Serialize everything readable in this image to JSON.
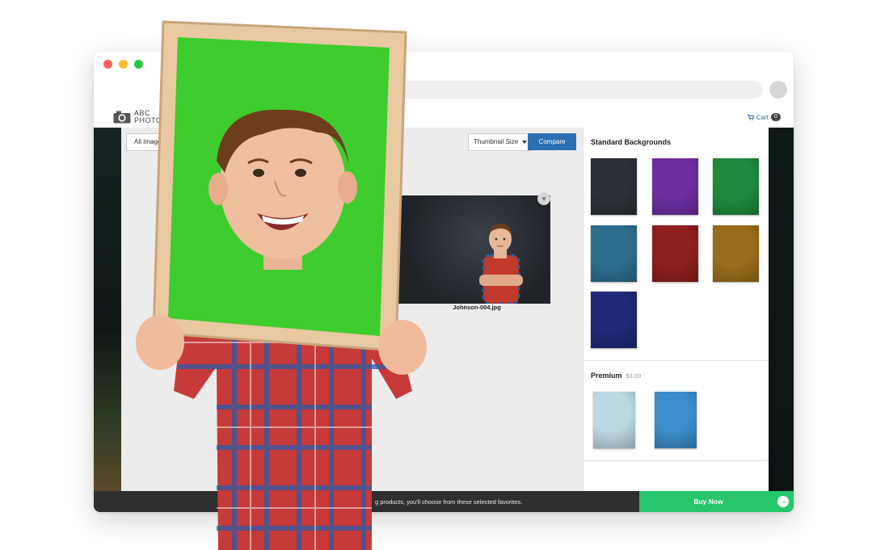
{
  "window": {
    "buttons": [
      "close",
      "minimize",
      "zoom"
    ]
  },
  "header": {
    "logo_line1": "ABC",
    "logo_line2": "PHOTOG",
    "cart_label": "Cart",
    "cart_count": "0",
    "cart_icon": "cart-icon",
    "logo_icon": "camera-icon"
  },
  "toolbar": {
    "all_images_label": "All Image",
    "thumbnail_size_label": "Thumbnail Size",
    "compare_label": "Compare"
  },
  "gallery": {
    "photo_filename": "Johnson-004.jpg",
    "favorite_icon": "heart-icon"
  },
  "sidebar": {
    "standard_heading": "Standard Backgrounds",
    "premium_heading": "Premium",
    "premium_price": "$3.00",
    "standard_swatches": [
      "#2d3138",
      "#6e2ea0",
      "#1f8a3c",
      "#2d6e8f",
      "#8e1f1f",
      "#9a6d1c",
      "#1f2a78"
    ],
    "premium_swatches": [
      "#bcd8e2",
      "#3d8cc9"
    ]
  },
  "footer": {
    "message": "g products, you'll choose from these selected favorites.",
    "buy_label": "Buy Now",
    "buy_icon": "arrow-right-icon"
  },
  "colors": {
    "accent_blue": "#2c6fb3",
    "buy_green": "#27c66b",
    "frame_green": "#3fcc2e"
  }
}
